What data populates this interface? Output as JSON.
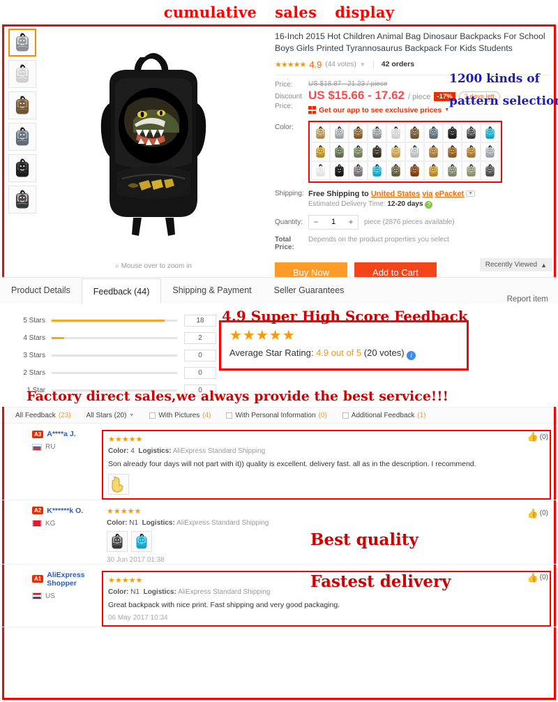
{
  "banner": {
    "words": [
      "cumulative",
      "sales",
      "display"
    ],
    "color": "#ff0000"
  },
  "product": {
    "title": "16-Inch 2015 Hot Children Animal Bag Dinosaur Backpacks For School Boys Girls Printed Tyrannosaurus Backpack For Kids Students",
    "rating": "4.9",
    "votes": "(44 votes)",
    "orders": "42 orders",
    "zoom_hint": "Mouse over to zoom in",
    "price_label": "Price:",
    "original_price": "US $18.87 - 21.23 / piece",
    "discount_label_1": "Discount",
    "discount_label_2": "Price:",
    "discount_price": "US $15.66 - 17.62",
    "per_piece": "/ piece",
    "discount_badge": "-17%",
    "days_left": "3 days left",
    "app_promo": "Get our app to see exclusive prices",
    "color_label": "Color:",
    "shipping_label": "Shipping:",
    "shipping_free": "Free Shipping to",
    "shipping_country": "United States",
    "shipping_via": "via",
    "shipping_method": "ePacket",
    "est_label": "Estimated Delivery Time:",
    "est_days": "12-20",
    "est_unit": "days",
    "qty_label": "Quantity:",
    "qty_value": "1",
    "qty_minus": "−",
    "qty_plus": "+",
    "qty_note": "piece (2876 pieces available)",
    "total_label": "Total Price:",
    "total_value": "Depends on the product properties you select",
    "buy_now": "Buy Now",
    "add_to_cart": "Add to Cart",
    "recently_viewed": "Recently Viewed",
    "swatch_count": 30,
    "thumb_count": 6
  },
  "annotations": {
    "pattern_line1": "1200 kinds of",
    "pattern_line2": "pattern selection",
    "feedback_score": "4.9 Super High Score Feedback",
    "factory": "Factory direct sales,we always provide the best service!!!",
    "best_quality": "Best quality",
    "fastest_delivery": "Fastest delivery",
    "blue": "#1a1ac4",
    "red": "#d00000"
  },
  "tabs": {
    "items": [
      {
        "label": "Product Details",
        "active": false
      },
      {
        "label": "Feedback (44)",
        "active": true
      },
      {
        "label": "Shipping & Payment",
        "active": false
      },
      {
        "label": "Seller Guarantees",
        "active": false
      }
    ],
    "report": "Report item"
  },
  "feedback": {
    "distribution": [
      {
        "label": "5 Stars",
        "count": "18",
        "pct": 90
      },
      {
        "label": "4 Stars",
        "count": "2",
        "pct": 10
      },
      {
        "label": "3 Stars",
        "count": "0",
        "pct": 0
      },
      {
        "label": "2 Stars",
        "count": "0",
        "pct": 0
      },
      {
        "label": "1 Star",
        "count": "0",
        "pct": 0
      }
    ],
    "avg_stars": "★★★★★",
    "avg_label": "Average Star Rating:",
    "avg_score": "4.9 out of 5",
    "avg_votes": "(20 votes)",
    "filters": [
      {
        "label": "All Feedback",
        "num": "(23)",
        "type": "link"
      },
      {
        "label": "All Stars (20)",
        "num": "",
        "type": "dropdown"
      },
      {
        "label": "With Pictures",
        "num": "(4)",
        "type": "checkbox"
      },
      {
        "label": "With Personal Information",
        "num": "(0)",
        "type": "checkbox"
      },
      {
        "label": "Additional Feedback",
        "num": "(1)",
        "type": "checkbox"
      }
    ]
  },
  "reviews": [
    {
      "level": "A3",
      "name": "A****a J.",
      "country": "RU",
      "flag_colors": [
        "#ffffff",
        "#3a5fbe",
        "#d52b1e"
      ],
      "stars": "★★★★★",
      "color_label": "Color:",
      "color_value": "4",
      "logistics_label": "Logistics:",
      "logistics_value": "AliExpress Standard Shipping",
      "text": "Son already four days will not part with it)) quality is excellent. delivery fast. all as in the description. I recommend.",
      "images": 1,
      "date": "",
      "likes": "(0)",
      "boxed": true
    },
    {
      "level": "A2",
      "name": "K******k O.",
      "country": "KG",
      "flag_colors": [
        "#e8112d",
        "#e8112d",
        "#e8112d"
      ],
      "stars": "★★★★★",
      "color_label": "Color:",
      "color_value": "N1",
      "logistics_label": "Logistics:",
      "logistics_value": "AliExpress Standard Shipping",
      "text": "",
      "images": 2,
      "date": "30 Jun 2017 01:38",
      "likes": "(0)",
      "boxed": false
    },
    {
      "level": "A1",
      "name": "AliExpress Shopper",
      "country": "US",
      "flag_colors": [
        "#b22234",
        "#ffffff",
        "#3c3b6e"
      ],
      "stars": "★★★★★",
      "color_label": "Color:",
      "color_value": "N1",
      "logistics_label": "Logistics:",
      "logistics_value": "AliExpress Standard Shipping",
      "text": "Great backpack with nice print. Fast shipping and very good packaging.",
      "images": 0,
      "date": "06 May 2017 10:34",
      "likes": "(0)",
      "boxed": true
    }
  ]
}
